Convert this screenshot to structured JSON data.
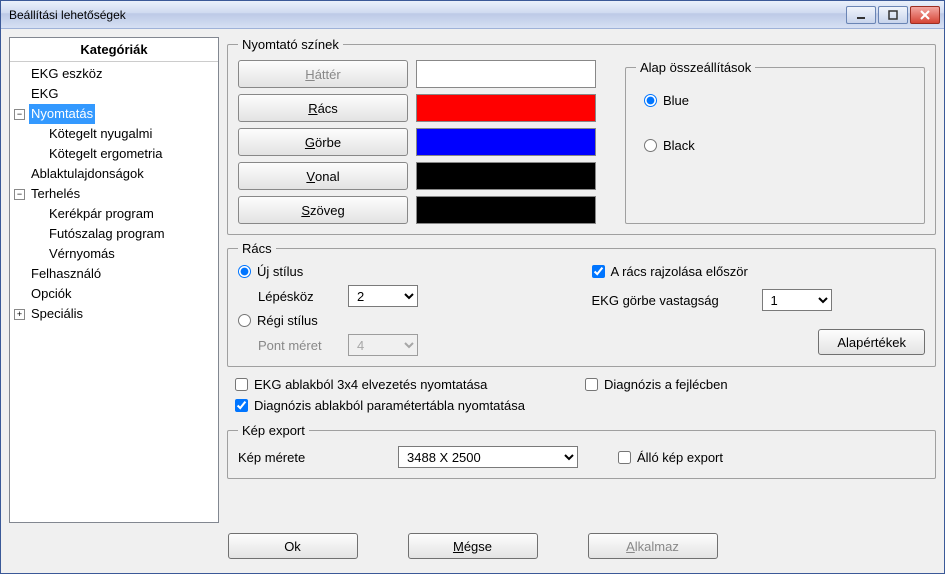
{
  "window": {
    "title": "Beállítási lehetőségek"
  },
  "tree": {
    "header": "Kategóriák",
    "items": [
      {
        "label": "EKG eszköz",
        "indent": 0,
        "exp": null
      },
      {
        "label": "EKG",
        "indent": 0,
        "exp": null
      },
      {
        "label": "Nyomtatás",
        "indent": 0,
        "exp": "minus",
        "selected": true
      },
      {
        "label": "Kötegelt nyugalmi",
        "indent": 1,
        "exp": null
      },
      {
        "label": "Kötegelt ergometria",
        "indent": 1,
        "exp": null
      },
      {
        "label": "Ablaktulajdonságok",
        "indent": 0,
        "exp": null
      },
      {
        "label": "Terhelés",
        "indent": 0,
        "exp": "minus"
      },
      {
        "label": "Kerékpár program",
        "indent": 1,
        "exp": null
      },
      {
        "label": "Futószalag program",
        "indent": 1,
        "exp": null
      },
      {
        "label": "Vérnyomás",
        "indent": 1,
        "exp": null
      },
      {
        "label": "Felhasználó",
        "indent": 0,
        "exp": null
      },
      {
        "label": "Opciók",
        "indent": 0,
        "exp": null
      },
      {
        "label": "Speciális",
        "indent": 0,
        "exp": "plus"
      }
    ]
  },
  "printerColors": {
    "legend": "Nyomtató színek",
    "rows": [
      {
        "name": "hatter",
        "label": "Háttér",
        "mnemonic": "H",
        "color": "#ffffff",
        "disabled": true
      },
      {
        "name": "racs",
        "label": "Rács",
        "mnemonic": "R",
        "color": "#ff0000",
        "disabled": false
      },
      {
        "name": "gorbe",
        "label": "Görbe",
        "mnemonic": "G",
        "color": "#0000ff",
        "disabled": false
      },
      {
        "name": "vonal",
        "label": "Vonal",
        "mnemonic": "V",
        "color": "#000000",
        "disabled": false
      },
      {
        "name": "szoveg",
        "label": "Szöveg",
        "mnemonic": "S",
        "color": "#000000",
        "disabled": false
      }
    ],
    "presets": {
      "legend": "Alap összeállítások",
      "options": [
        {
          "name": "blue",
          "label": "Blue",
          "checked": true
        },
        {
          "name": "black",
          "label": "Black",
          "checked": false
        }
      ]
    }
  },
  "grid": {
    "legend": "Rács",
    "newStyle": {
      "label": "Új stílus",
      "checked": true
    },
    "oldStyle": {
      "label": "Régi stílus",
      "checked": false
    },
    "step": {
      "label": "Lépésköz",
      "value": "2"
    },
    "pointSize": {
      "label": "Pont méret",
      "value": "4"
    },
    "drawGridFirst": {
      "label": "A rács rajzolása először",
      "checked": true
    },
    "curveWidth": {
      "label": "EKG görbe vastagság",
      "value": "1"
    },
    "defaultsButton": "Alapértékek"
  },
  "checks": {
    "print3x4": {
      "label": "EKG ablakból 3x4 elvezetés nyomtatása",
      "checked": false
    },
    "printParamTable": {
      "label": "Diagnózis ablakból paramétertábla nyomtatása",
      "checked": true
    },
    "diagHeader": {
      "label": "Diagnózis a fejlécben",
      "checked": false
    }
  },
  "export": {
    "legend": "Kép export",
    "sizeLabel": "Kép mérete",
    "sizeValue": "3488 X 2500",
    "portrait": {
      "label": "Álló kép export",
      "checked": false
    }
  },
  "buttons": {
    "ok": "Ok",
    "cancel": "Mégse",
    "cancel_mnemonic": "M",
    "apply": "Alkalmaz",
    "apply_mnemonic": "A"
  }
}
